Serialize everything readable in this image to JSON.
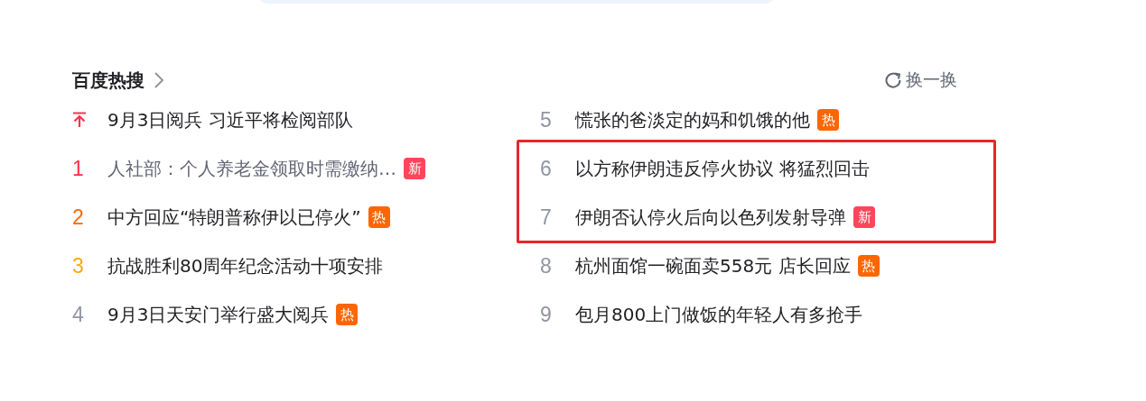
{
  "header": {
    "title": "百度热搜",
    "refresh_label": "换一换"
  },
  "columns": [
    {
      "items": [
        {
          "kind": "pinned",
          "color": "#f4354e",
          "title": "9月3日阅兵 习近平将检阅部队",
          "visited": false,
          "highlighted": false
        },
        {
          "kind": "ranked",
          "rank": "1",
          "color": "#fe2d46",
          "title": "人社部：个人养老金领取时需缴纳…",
          "visited": true,
          "highlighted": false,
          "badge": {
            "kind": "new",
            "text": "新"
          }
        },
        {
          "kind": "ranked",
          "rank": "2",
          "color": "#ff6600",
          "title": "中方回应“特朗普称伊以已停火”",
          "visited": false,
          "highlighted": false,
          "badge": {
            "kind": "hot",
            "text": "热"
          }
        },
        {
          "kind": "ranked",
          "rank": "3",
          "color": "#faa90e",
          "title": "抗战胜利80周年纪念活动十项安排",
          "visited": false,
          "highlighted": false
        },
        {
          "kind": "ranked",
          "rank": "4",
          "color": "#9195a3",
          "title": "9月3日天安门举行盛大阅兵",
          "visited": false,
          "highlighted": false,
          "badge": {
            "kind": "hot",
            "text": "热"
          }
        }
      ]
    },
    {
      "items": [
        {
          "kind": "ranked",
          "rank": "5",
          "color": "#9195a3",
          "title": "慌张的爸淡定的妈和饥饿的他",
          "visited": false,
          "highlighted": false,
          "badge": {
            "kind": "hot",
            "text": "热"
          }
        },
        {
          "kind": "ranked",
          "rank": "6",
          "color": "#9195a3",
          "title": "以方称伊朗违反停火协议 将猛烈回击",
          "visited": false,
          "highlighted": true
        },
        {
          "kind": "ranked",
          "rank": "7",
          "color": "#9195a3",
          "title": "伊朗否认停火后向以色列发射导弹",
          "visited": false,
          "highlighted": true,
          "badge": {
            "kind": "new",
            "text": "新"
          }
        },
        {
          "kind": "ranked",
          "rank": "8",
          "color": "#9195a3",
          "title": "杭州面馆一碗面卖558元 店长回应",
          "visited": false,
          "highlighted": false,
          "badge": {
            "kind": "hot",
            "text": "热"
          }
        },
        {
          "kind": "ranked",
          "rank": "9",
          "color": "#9195a3",
          "title": "包月800上门做饭的年轻人有多抢手",
          "visited": false,
          "highlighted": false
        }
      ]
    }
  ]
}
